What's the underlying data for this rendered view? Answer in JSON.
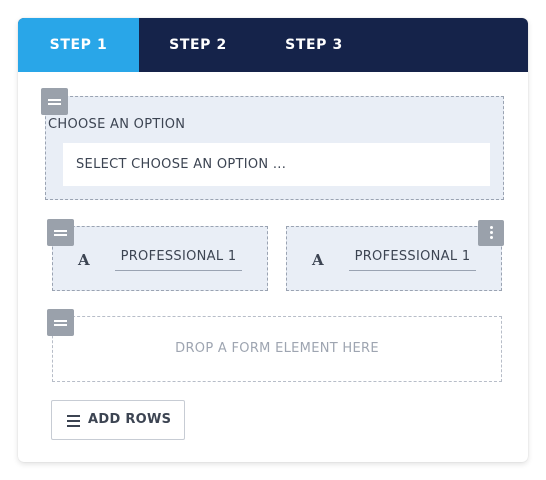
{
  "tabs": [
    {
      "label": "STEP 1",
      "active": true
    },
    {
      "label": "STEP 2",
      "active": false
    },
    {
      "label": "STEP 3",
      "active": false
    }
  ],
  "row1": {
    "field_label": "CHOOSE AN OPTION",
    "select_value": "SELECT CHOOSE AN OPTION ..."
  },
  "row2": {
    "left": {
      "icon": "A",
      "value": "PROFESSIONAL 1"
    },
    "right": {
      "icon": "A",
      "value": "PROFESSIONAL 1"
    }
  },
  "row3": {
    "drop_text": "DROP A FORM ELEMENT HERE"
  },
  "add_rows": {
    "label": "ADD ROWS"
  },
  "colors": {
    "tab_bar": "#15234a",
    "active_tab": "#29a6e8",
    "panel": "#e9eef6",
    "handle": "#9aa1ab"
  }
}
